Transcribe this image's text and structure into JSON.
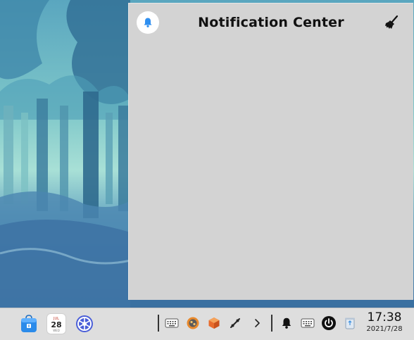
{
  "notification_center": {
    "title": "Notification Center",
    "header_icon": "bell-icon",
    "clear_icon": "broom-icon"
  },
  "taskbar": {
    "apps": [
      {
        "name": "software-store",
        "icon": "store-bag-icon"
      },
      {
        "name": "calendar",
        "icon": "calendar-icon",
        "month": "JUL",
        "day": "28",
        "weekday": "WED"
      },
      {
        "name": "system-settings",
        "icon": "settings-wheel-icon"
      }
    ],
    "tray": [
      {
        "name": "keyboard",
        "icon": "keyboard-icon"
      },
      {
        "name": "network-app",
        "icon": "orange-app-icon"
      },
      {
        "name": "package-app",
        "icon": "box-icon"
      },
      {
        "name": "pen-tool",
        "icon": "pen-icon"
      },
      {
        "name": "expand",
        "icon": "chevron-right-icon"
      },
      {
        "name": "notifications",
        "icon": "bell-icon"
      },
      {
        "name": "input-method",
        "icon": "keyboard-icon"
      },
      {
        "name": "power",
        "icon": "power-icon"
      },
      {
        "name": "trash",
        "icon": "trash-icon"
      }
    ],
    "clock": {
      "time": "17:38",
      "date": "2021/7/28"
    }
  },
  "colors": {
    "panel_bg": "#d3d3d3",
    "taskbar_bg": "#dedede",
    "accent_blue": "#2f8ff0"
  }
}
